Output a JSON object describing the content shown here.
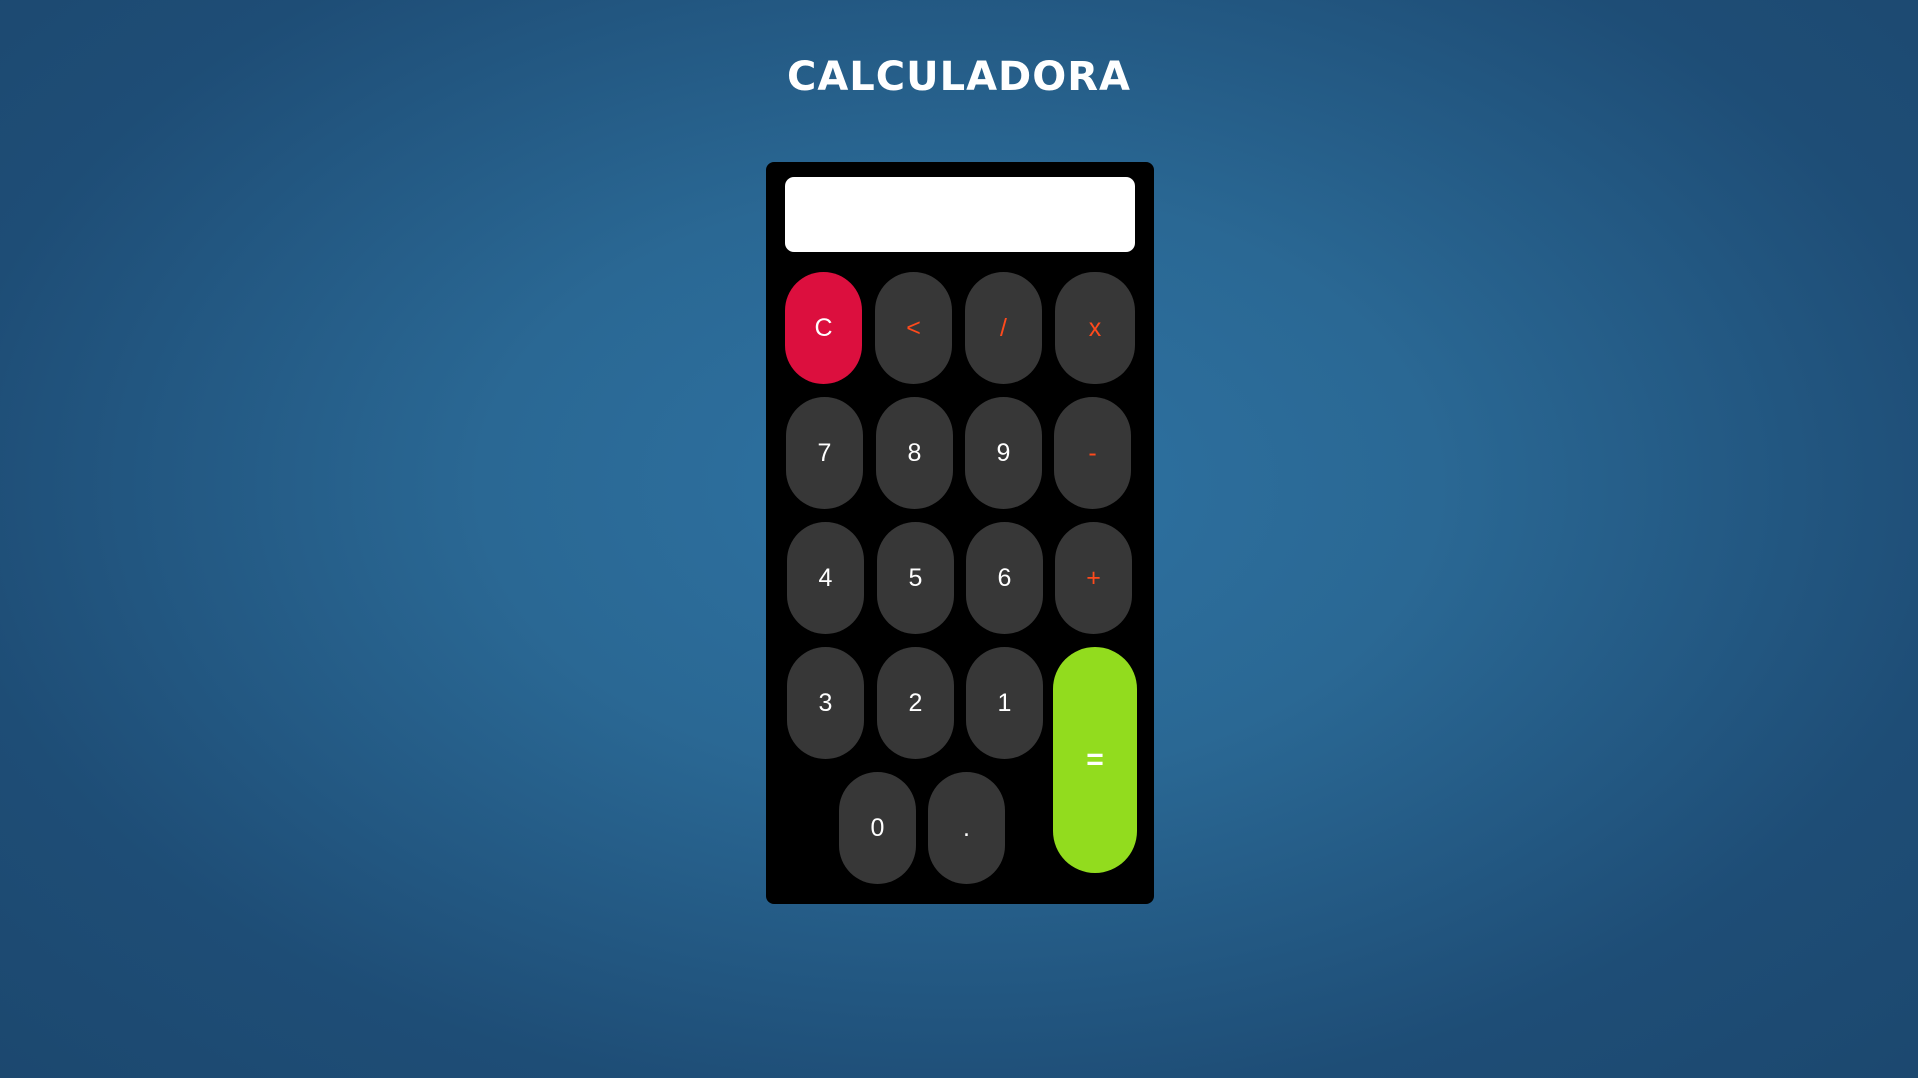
{
  "title": "CALCULADORA",
  "display": {
    "value": ""
  },
  "keys": {
    "clear": "C",
    "backspace": "<",
    "divide": "/",
    "multiply": "x",
    "seven": "7",
    "eight": "8",
    "nine": "9",
    "minus": "-",
    "four": "4",
    "five": "5",
    "six": "6",
    "plus": "+",
    "three": "3",
    "two": "2",
    "one": "1",
    "equals": "=",
    "zero": "0",
    "decimal": "."
  },
  "colors": {
    "background": "#2a6894",
    "calculator_body": "#000000",
    "key": "#373737",
    "operator_text": "#ff4a1c",
    "clear_key": "#dc0f3e",
    "equals_key": "#92dc1e"
  }
}
